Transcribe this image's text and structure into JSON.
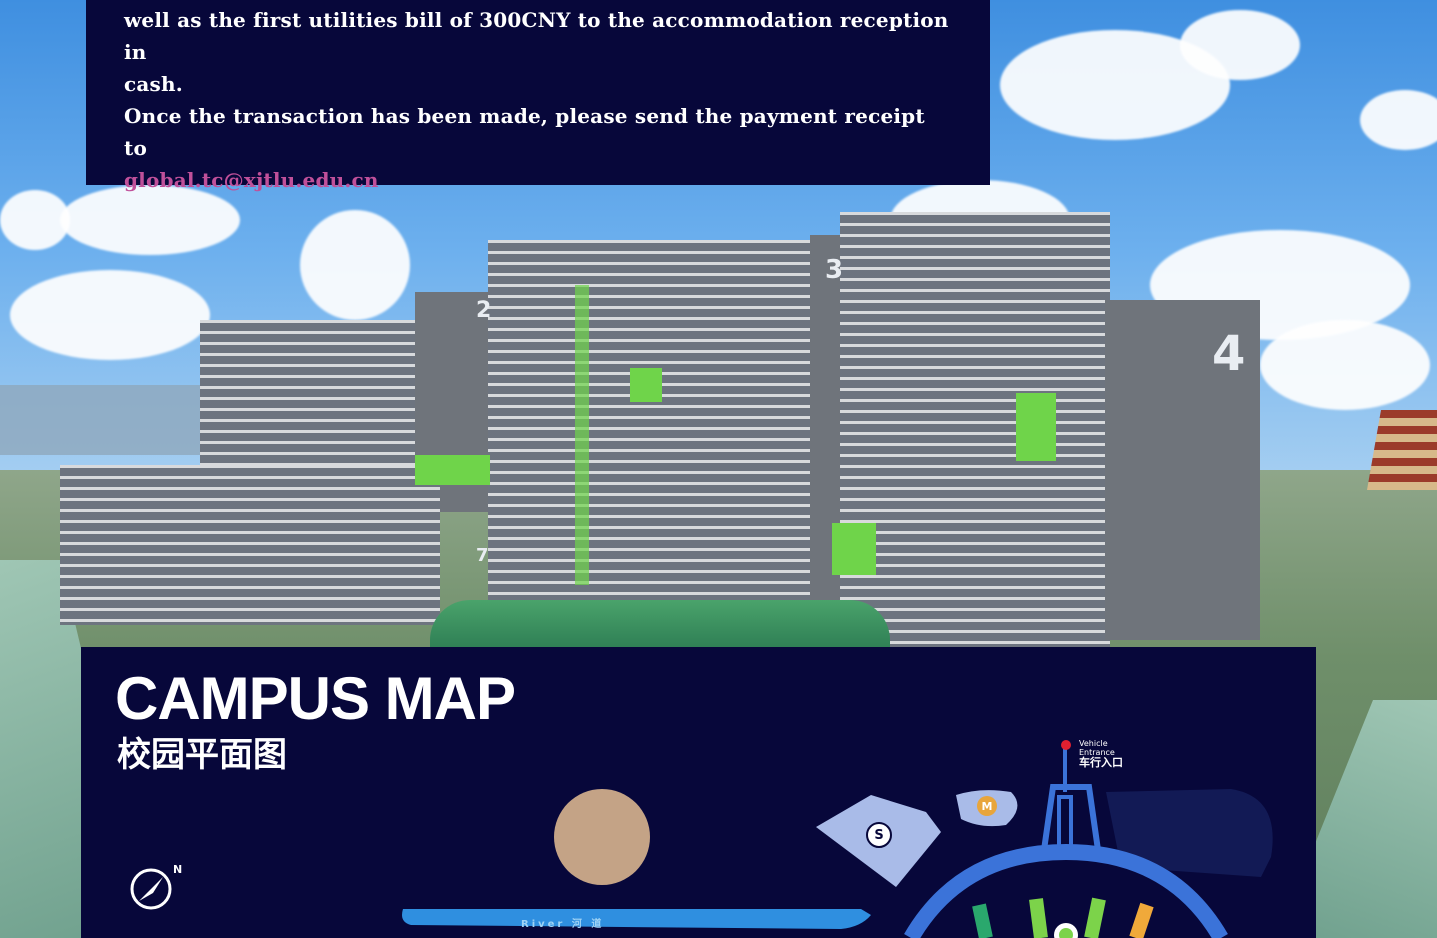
{
  "info_panel": {
    "line1": "well as the first utilities bill of 300CNY to the accommodation reception in",
    "line2": "cash.",
    "line3": "Once the transaction has been made, please send the payment receipt to",
    "email": "global.tc@xjtlu.edu.cn"
  },
  "photo": {
    "building_numbers": [
      "2",
      "3",
      "4",
      "7"
    ]
  },
  "campus_map": {
    "title": "CAMPUS MAP",
    "subtitle_cn": "校园平面图",
    "compass_label": "N",
    "river_label": "River   河 道",
    "vehicle_entrance_en_1": "Vehicle",
    "vehicle_entrance_en_2": "Entrance",
    "vehicle_entrance_cn": "车行入口",
    "building_s": "S",
    "building_m": "M"
  },
  "colors": {
    "panel_bg": "#07073a",
    "email_link": "#c0509a",
    "map_shape": "#a9bbe8",
    "route": "#3b73d9",
    "tan_marker": "#c4a386"
  }
}
